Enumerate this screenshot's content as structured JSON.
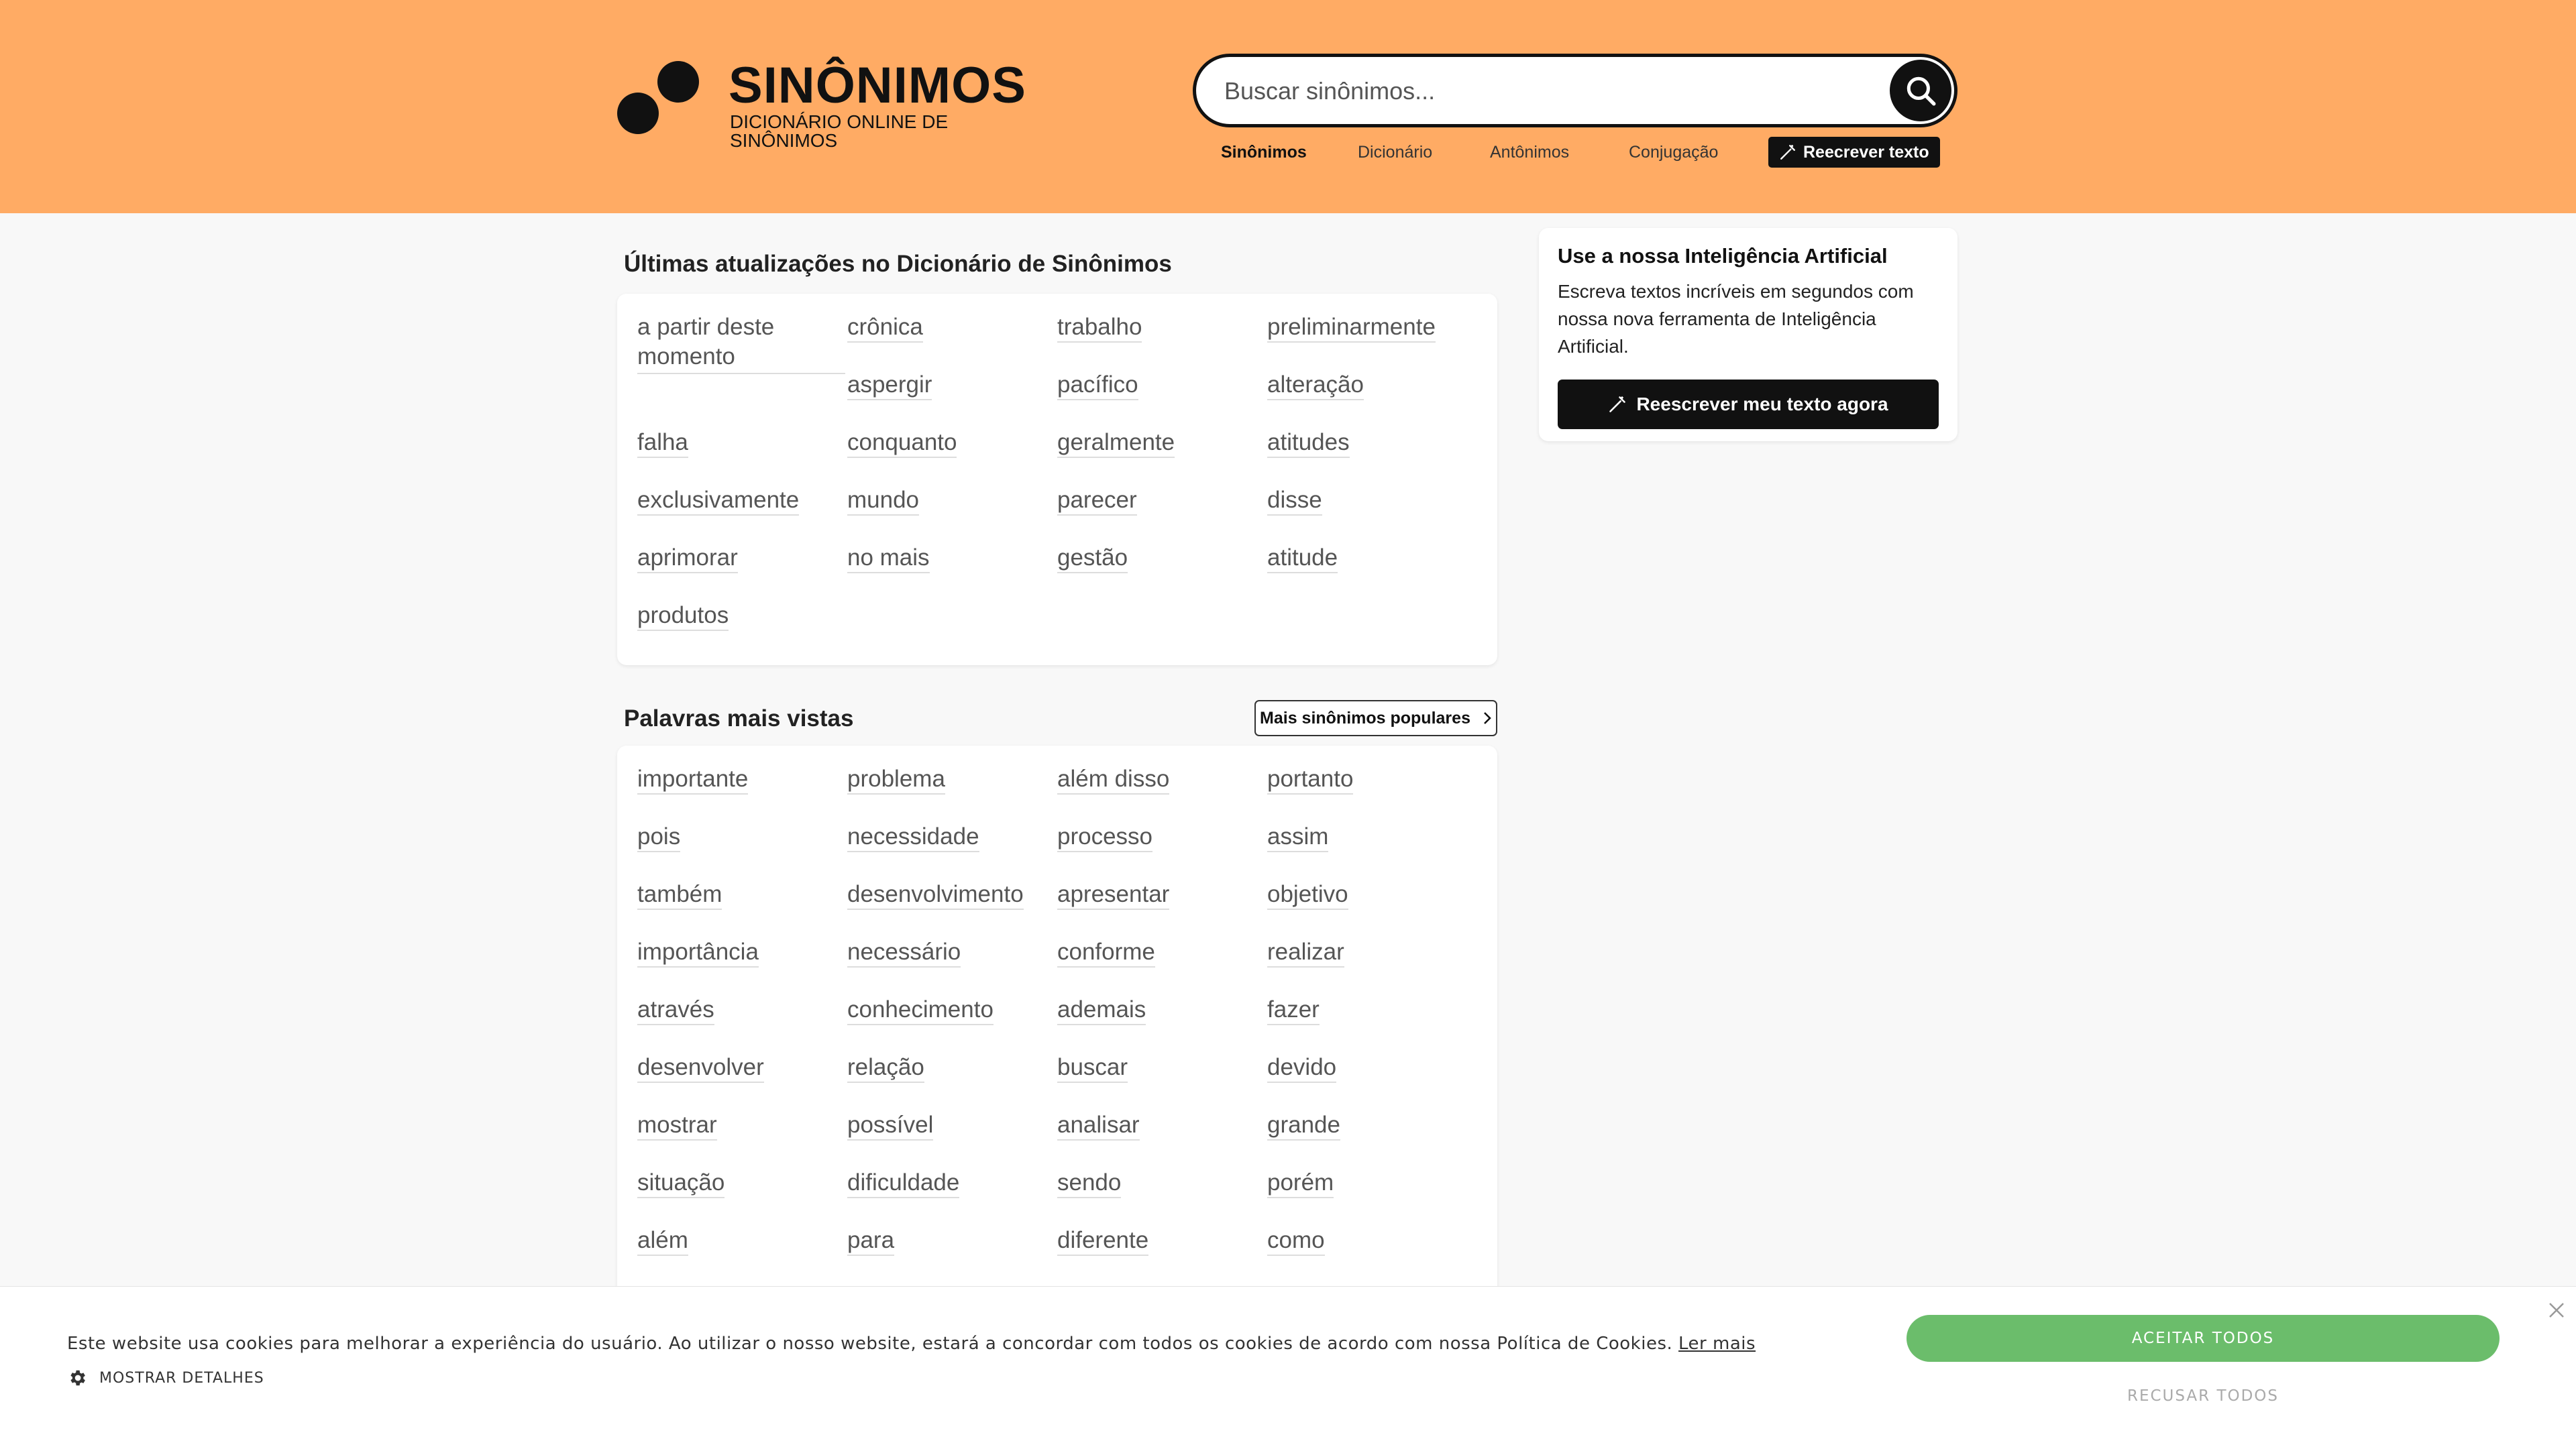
{
  "header": {
    "logo_title": "SINÔNIMOS",
    "logo_subtitle": "DICIONÁRIO ONLINE DE SINÔNIMOS",
    "search_placeholder": "Buscar sinônimos...",
    "nav": {
      "sinonimos": "Sinônimos",
      "dicionario": "Dicionário",
      "antonimos": "Antônimos",
      "conjugacao": "Conjugação",
      "rewrite": "Reecrever texto"
    }
  },
  "updates": {
    "title": "Últimas atualizações no Dicionário de Sinônimos",
    "words": [
      "a partir deste momento",
      "crônica",
      "trabalho",
      "preliminarmente",
      "aspergir",
      "pacífico",
      "alteração",
      "falha",
      "conquanto",
      "geralmente",
      "atitudes",
      "exclusivamente",
      "mundo",
      "parecer",
      "disse",
      "aprimorar",
      "no mais",
      "gestão",
      "atitude",
      "produtos"
    ]
  },
  "popular": {
    "title": "Palavras mais vistas",
    "more_button": "Mais sinônimos populares",
    "words": [
      "importante",
      "problema",
      "além disso",
      "portanto",
      "pois",
      "necessidade",
      "processo",
      "assim",
      "também",
      "desenvolvimento",
      "apresentar",
      "objetivo",
      "importância",
      "necessário",
      "conforme",
      "realizar",
      "através",
      "conhecimento",
      "ademais",
      "fazer",
      "desenvolver",
      "relação",
      "buscar",
      "devido",
      "mostrar",
      "possível",
      "analisar",
      "grande",
      "situação",
      "dificuldade",
      "sendo",
      "porém",
      "além",
      "para",
      "diferente",
      "como"
    ]
  },
  "ai": {
    "title": "Use a nossa Inteligência Artificial",
    "text": "Escreva textos incríveis em segundos com nossa nova ferramenta de Inteligência Artificial.",
    "button": "Reescrever meu texto agora"
  },
  "cookie": {
    "text": "Este website usa cookies para melhorar a experiência do usuário. Ao utilizar o nosso website, estará a concordar com todos os cookies de acordo com nossa Política de Cookies.",
    "link": "Ler mais",
    "details": "MOSTRAR DETALHES",
    "accept": "ACEITAR TODOS",
    "refuse": "RECUSAR TODOS"
  },
  "colors": {
    "header_bg": "#ffab64",
    "accept_green": "#6bbd6b",
    "dark": "#111111"
  }
}
